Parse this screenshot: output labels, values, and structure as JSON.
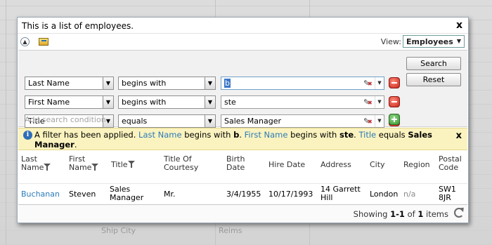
{
  "background": {
    "labels": [
      "Ship City",
      "Reims"
    ]
  },
  "popup": {
    "title": "This is a list of employees.",
    "close_label": "x",
    "view_label": "View:",
    "view_value": "Employees"
  },
  "search": {
    "conditions": [
      {
        "field": "Last Name",
        "operator": "begins with",
        "value": "b"
      },
      {
        "field": "First Name",
        "operator": "begins with",
        "value": "ste"
      },
      {
        "field": "Title",
        "operator": "equals",
        "value": "Sales Manager"
      }
    ],
    "add_condition_placeholder": "Add search condition",
    "search_button": "Search",
    "reset_button": "Reset"
  },
  "notice": {
    "prefix": "A filter has been applied.",
    "f1_field": "Last Name",
    "f1_op": "begins with",
    "f1_val": "b",
    "f2_field": "First Name",
    "f2_op": "begins with",
    "f2_val": "ste",
    "f3_field": "Title",
    "f3_op": "equals",
    "f3_val": "Sales Manager",
    "close_label": "x"
  },
  "grid": {
    "columns": [
      {
        "l1": "Last",
        "l2": "Name"
      },
      {
        "l1": "First",
        "l2": "Name"
      },
      {
        "l1": "Title",
        "l2": ""
      },
      {
        "l1": "Title Of",
        "l2": "Courtesy"
      },
      {
        "l1": "Birth",
        "l2": "Date"
      },
      {
        "l1": "Hire Date",
        "l2": ""
      },
      {
        "l1": "Address",
        "l2": ""
      },
      {
        "l1": "City",
        "l2": ""
      },
      {
        "l1": "Region",
        "l2": ""
      },
      {
        "l1": "Postal",
        "l2": "Code"
      }
    ],
    "row": {
      "last_name": "Buchanan",
      "first_name": "Steven",
      "title_l1": "Sales",
      "title_l2": "Manager",
      "courtesy": "Mr.",
      "birth_date": "3/4/1955",
      "hire_date": "10/17/1993",
      "address_l1": "14 Garrett",
      "address_l2": "Hill",
      "city": "London",
      "region": "n/a",
      "postal_l1": "SW1",
      "postal_l2": "8JR"
    }
  },
  "footer": {
    "showing": "Showing",
    "range": "1-1",
    "of": "of",
    "total": "1",
    "items": "items"
  }
}
